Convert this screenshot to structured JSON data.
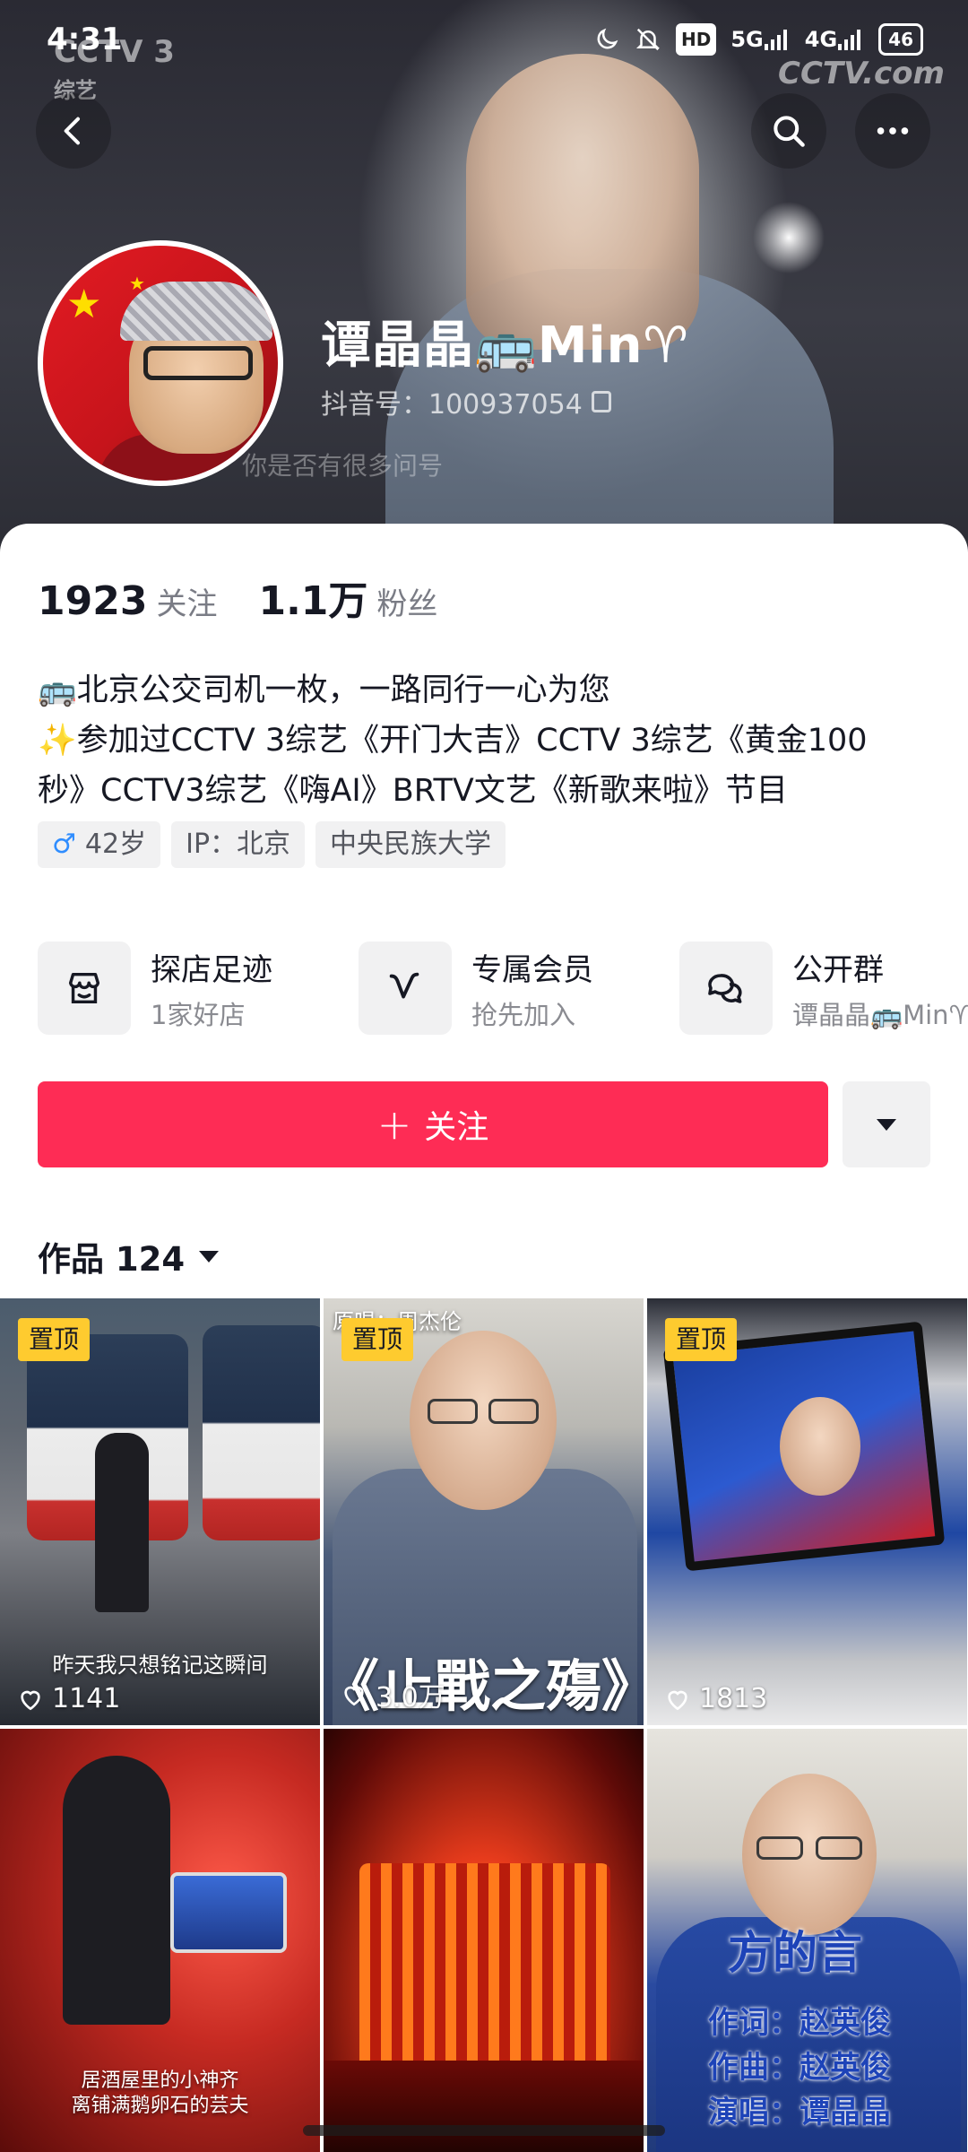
{
  "status_bar": {
    "time": "4:31",
    "network_badge": "HD",
    "signal_1": "5G",
    "signal_2": "4G",
    "battery": "46"
  },
  "cover": {
    "watermark_left": "CCTV 3",
    "watermark_left_sub": "综艺",
    "watermark_right": "CCTV.com",
    "subtitle": "你是否有很多问号"
  },
  "profile": {
    "name": "谭晶晶🚌Min♈",
    "douyin_id": "抖音号：100937054"
  },
  "stats": [
    {
      "value": "1923",
      "label": "关注"
    },
    {
      "value": "1.1万",
      "label": "粉丝"
    }
  ],
  "bio": {
    "line1": "🚌北京公交司机一枚，一路同行一心为您",
    "line2": "✨参加过CCTV 3综艺《开门大吉》CCTV 3综艺《黄金100",
    "line3": "秒》CCTV3综艺《嗨AI》BRTV文艺《新歌来啦》节目"
  },
  "tags": {
    "gender_symbol": "♂",
    "age": "42岁",
    "ip": "IP：北京",
    "school": "中央民族大学"
  },
  "features": [
    {
      "title": "探店足迹",
      "subtitle": "1家好店",
      "icon": "store-icon"
    },
    {
      "title": "专属会员",
      "subtitle": "抢先加入",
      "icon": "v-badge-icon"
    },
    {
      "title": "公开群",
      "subtitle": "谭晶晶🚌Min♈",
      "icon": "chat-bubbles-icon"
    }
  ],
  "actions": {
    "follow_label": "关注"
  },
  "works": {
    "label": "作品 124"
  },
  "videos": [
    {
      "pinned": "置顶",
      "likes": "1141",
      "caption": "昨天我只想铭记这瞬间"
    },
    {
      "pinned": "置顶",
      "likes": "3.0万",
      "caption_top": "原唱：周杰伦",
      "caption": "《止戰之殤》"
    },
    {
      "pinned": "置顶",
      "likes": "1813"
    },
    {
      "caption_line1": "居酒屋里的小神齐",
      "caption_line2": "离铺满鹅卵石的芸夫"
    },
    {},
    {
      "caption_title": "方的言",
      "caption_line1": "作词：赵英俊",
      "caption_line2": "作曲：赵英俊",
      "caption_line3": "演唱：谭晶晶"
    }
  ],
  "colors": {
    "follow_button": "#fe2c55",
    "pinned_badge": "#fecb2f",
    "text_primary": "#161823",
    "text_secondary": "#7a7c85"
  }
}
